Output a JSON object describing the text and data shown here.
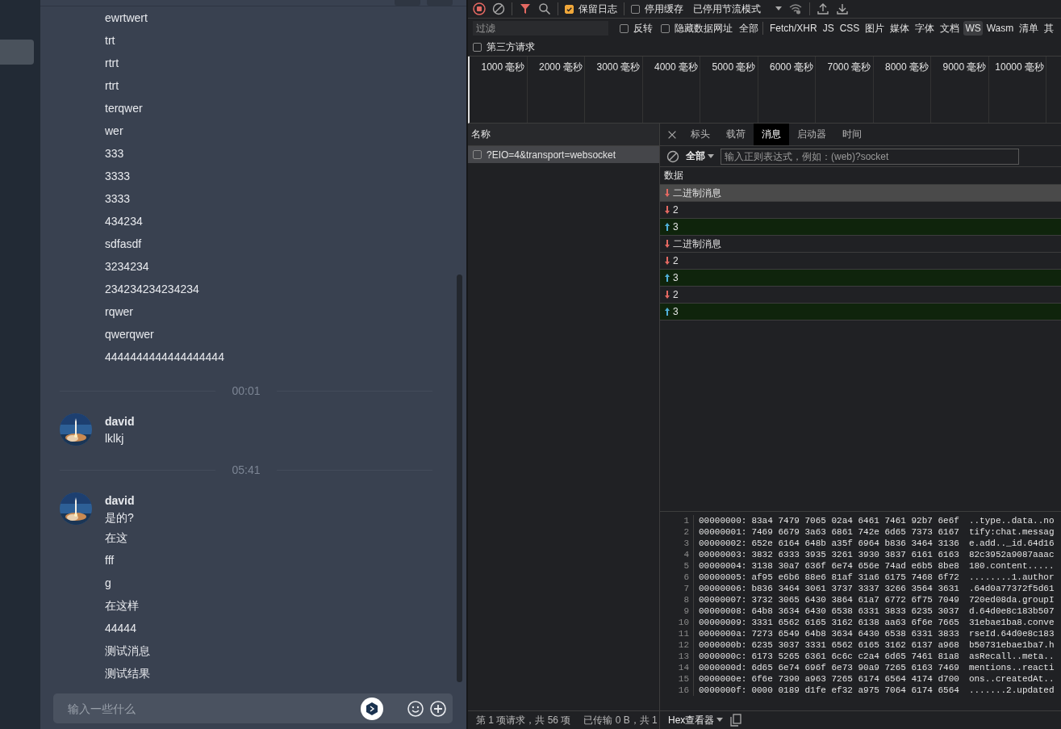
{
  "sidebar": {
    "items": [
      {
        "selected": true
      }
    ]
  },
  "chat": {
    "feed": [
      {
        "kind": "line",
        "text": "ewrtwert"
      },
      {
        "kind": "line",
        "text": "trt"
      },
      {
        "kind": "line",
        "text": "rtrt"
      },
      {
        "kind": "line",
        "text": "rtrt"
      },
      {
        "kind": "line",
        "text": "terqwer"
      },
      {
        "kind": "line",
        "text": "wer"
      },
      {
        "kind": "line",
        "text": "333"
      },
      {
        "kind": "line",
        "text": "3333"
      },
      {
        "kind": "line",
        "text": "3333"
      },
      {
        "kind": "line",
        "text": "434234"
      },
      {
        "kind": "line",
        "text": "sdfasdf"
      },
      {
        "kind": "line",
        "text": "3234234"
      },
      {
        "kind": "line",
        "text": "234234234234234"
      },
      {
        "kind": "line",
        "text": "rqwer"
      },
      {
        "kind": "line",
        "text": "qwerqwer"
      },
      {
        "kind": "line",
        "text": "4444444444444444444"
      },
      {
        "kind": "time",
        "text": "00:01"
      },
      {
        "kind": "message",
        "author": "david",
        "lines": [
          "lklkj"
        ]
      },
      {
        "kind": "time",
        "text": "05:41"
      },
      {
        "kind": "message",
        "author": "david",
        "lines": [
          "是的?",
          "在这",
          "fff",
          "g",
          "在这样",
          "44444",
          "测试消息",
          "测试结果"
        ]
      }
    ],
    "input": {
      "placeholder": "输入一些什么"
    }
  },
  "devtools": {
    "toolbar": {
      "recording": true,
      "filter_active": true,
      "preserve_log": {
        "label": "保留日志",
        "checked": true
      },
      "disable_cache": {
        "label": "停用缓存",
        "checked": false
      },
      "throttling": "已停用节流模式"
    },
    "filter": {
      "placeholder": "过滤",
      "invert": {
        "label": "反转",
        "checked": false
      },
      "hide_data_urls": {
        "label": "隐藏数据网址",
        "checked": false
      },
      "types": [
        {
          "label": "全部",
          "selected": false
        },
        {
          "label": "Fetch/XHR",
          "selected": false
        },
        {
          "label": "JS",
          "selected": false
        },
        {
          "label": "CSS",
          "selected": false
        },
        {
          "label": "图片",
          "selected": false
        },
        {
          "label": "媒体",
          "selected": false
        },
        {
          "label": "字体",
          "selected": false
        },
        {
          "label": "文档",
          "selected": false
        },
        {
          "label": "WS",
          "selected": true
        },
        {
          "label": "Wasm",
          "selected": false
        },
        {
          "label": "清单",
          "selected": false
        },
        {
          "label": "其",
          "selected": false
        }
      ],
      "third_party": {
        "label": "第三方请求",
        "checked": false
      }
    },
    "timeline": {
      "ticks": [
        "1000 毫秒",
        "2000 毫秒",
        "3000 毫秒",
        "4000 毫秒",
        "5000 毫秒",
        "6000 毫秒",
        "7000 毫秒",
        "8000 毫秒",
        "9000 毫秒",
        "10000 毫秒"
      ]
    },
    "requests": {
      "column": "名称",
      "rows": [
        {
          "name": "?EIO=4&transport=websocket",
          "selected": true
        }
      ]
    },
    "detail": {
      "tabs": [
        {
          "label": "标头",
          "selected": false
        },
        {
          "label": "载荷",
          "selected": false
        },
        {
          "label": "消息",
          "selected": true
        },
        {
          "label": "启动器",
          "selected": false
        },
        {
          "label": "时间",
          "selected": false
        }
      ],
      "message_filter": {
        "type": "全部",
        "placeholder": "输入正则表达式，例如：(web)?socket"
      },
      "column": "数据",
      "messages": [
        {
          "kind": "received",
          "text": "二进制消息",
          "selected": true
        },
        {
          "kind": "received",
          "text": "2",
          "selected": false
        },
        {
          "kind": "sent",
          "text": "3",
          "selected": false
        },
        {
          "kind": "received",
          "text": "二进制消息",
          "selected": false
        },
        {
          "kind": "received",
          "text": "2",
          "selected": false
        },
        {
          "kind": "sent",
          "text": "3",
          "selected": false
        },
        {
          "kind": "received",
          "text": "2",
          "selected": false
        },
        {
          "kind": "sent",
          "text": "3",
          "selected": false
        }
      ],
      "hex": [
        {
          "n": "1",
          "offset": "00000000:",
          "bytes": "83a4 7479 7065 02a4 6461 7461 92b7 6e6f",
          "ascii": "..type..data..no"
        },
        {
          "n": "2",
          "offset": "00000001:",
          "bytes": "7469 6679 3a63 6861 742e 6d65 7373 6167",
          "ascii": "tify:chat.messag"
        },
        {
          "n": "3",
          "offset": "00000002:",
          "bytes": "652e 6164 648b a35f 6964 b836 3464 3136",
          "ascii": "e.add.._id.64d16"
        },
        {
          "n": "4",
          "offset": "00000003:",
          "bytes": "3832 6333 3935 3261 3930 3837 6161 6163",
          "ascii": "82c3952a9087aaac"
        },
        {
          "n": "5",
          "offset": "00000004:",
          "bytes": "3138 30a7 636f 6e74 656e 74ad e6b5 8be8",
          "ascii": "180.content....."
        },
        {
          "n": "6",
          "offset": "00000005:",
          "bytes": "af95 e6b6 88e6 81af 31a6 6175 7468 6f72",
          "ascii": "........1.author"
        },
        {
          "n": "7",
          "offset": "00000006:",
          "bytes": "b836 3464 3061 3737 3337 3266 3564 3631",
          "ascii": ".64d0a77372f5d61"
        },
        {
          "n": "8",
          "offset": "00000007:",
          "bytes": "3732 3065 6430 3864 61a7 6772 6f75 7049",
          "ascii": "720ed08da.groupI"
        },
        {
          "n": "9",
          "offset": "00000008:",
          "bytes": "64b8 3634 6430 6538 6331 3833 6235 3037",
          "ascii": "d.64d0e8c183b507"
        },
        {
          "n": "10",
          "offset": "00000009:",
          "bytes": "3331 6562 6165 3162 6138 aa63 6f6e 7665",
          "ascii": "31ebae1ba8.conve"
        },
        {
          "n": "11",
          "offset": "0000000a:",
          "bytes": "7273 6549 64b8 3634 6430 6538 6331 3833",
          "ascii": "rseId.64d0e8c183"
        },
        {
          "n": "12",
          "offset": "0000000b:",
          "bytes": "6235 3037 3331 6562 6165 3162 6137 a968",
          "ascii": "b50731ebae1ba7.h"
        },
        {
          "n": "13",
          "offset": "0000000c:",
          "bytes": "6173 5265 6361 6c6c c2a4 6d65 7461 81a8",
          "ascii": "asRecall..meta.."
        },
        {
          "n": "14",
          "offset": "0000000d:",
          "bytes": "6d65 6e74 696f 6e73 90a9 7265 6163 7469",
          "ascii": "mentions..reacti"
        },
        {
          "n": "15",
          "offset": "0000000e:",
          "bytes": "6f6e 7390 a963 7265 6174 6564 4174 d700",
          "ascii": "ons..createdAt.."
        },
        {
          "n": "16",
          "offset": "0000000f:",
          "bytes": "0000 0189 d1fe ef32 a975 7064 6174 6564",
          "ascii": ".......2.updated"
        }
      ],
      "viewer": "Hex查看器"
    },
    "status_bar": [
      "第 1 项请求，共 56 项",
      "已传输 0 B，共 1"
    ]
  }
}
